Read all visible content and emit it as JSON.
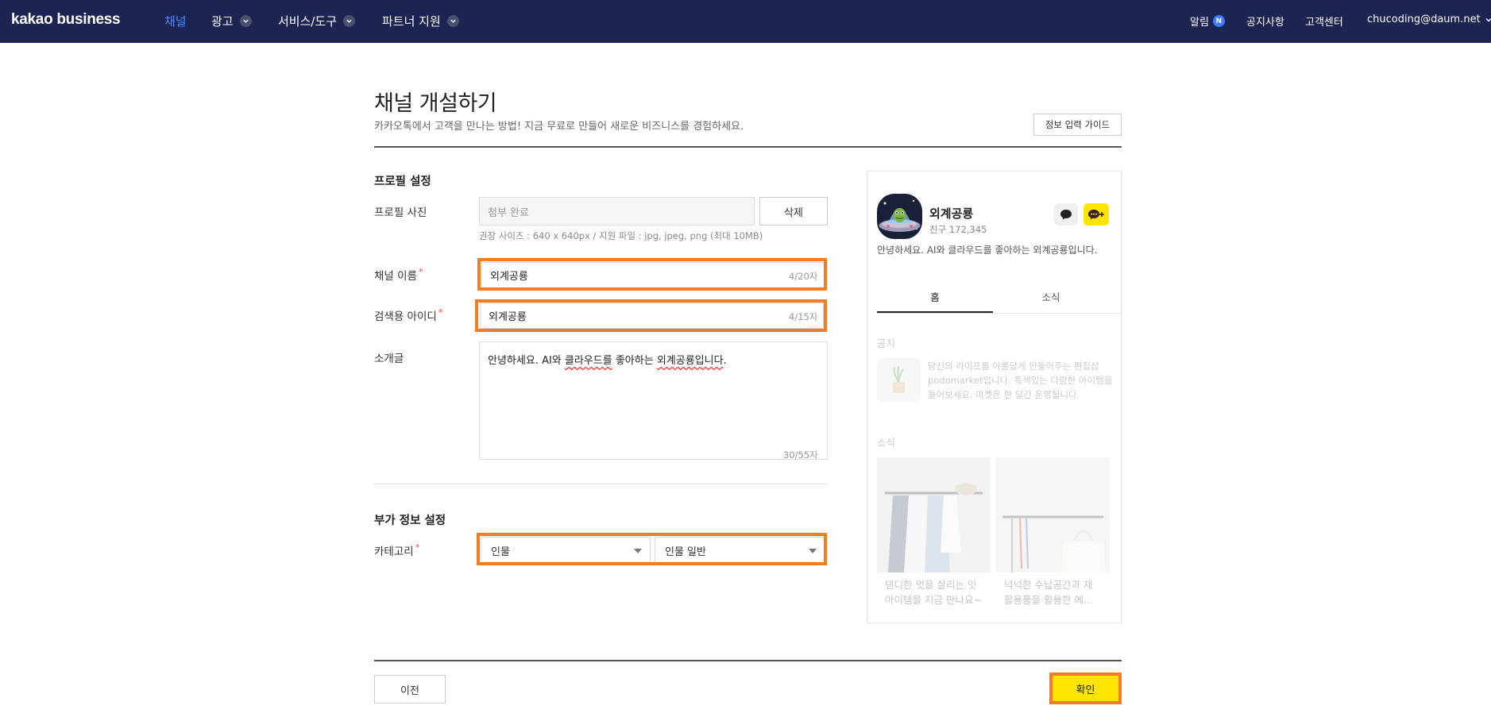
{
  "nav": {
    "logo": "kakao business",
    "items": [
      {
        "label": "채널",
        "active": true
      },
      {
        "label": "광고",
        "has_dropdown": true
      },
      {
        "label": "서비스/도구",
        "has_dropdown": true
      },
      {
        "label": "파트너 지원",
        "has_dropdown": true
      }
    ],
    "right": {
      "notifications": "알림",
      "badge": "N",
      "notices": "공지사항",
      "support": "고객센터",
      "account": "chucoding@daum.net"
    }
  },
  "header": {
    "title": "채널 개설하기",
    "subtitle": "카카오톡에서 고객을 만나는 방법! 지금 무료로 만들어 새로운 비즈니스를 경험하세요.",
    "guide_button": "정보 입력 가이드"
  },
  "profile": {
    "section_title": "프로필 설정",
    "photo": {
      "label": "프로필 사진",
      "value": "첨부 완료",
      "delete_label": "삭제",
      "hint": "권장 사이즈 : 640 x 640px / 지원 파일 : jpg, jpeg, png (최대 10MB)"
    },
    "channel_name": {
      "label": "채널 이름",
      "required": "*",
      "value": "외계공룡",
      "counter": "4/20자"
    },
    "search_id": {
      "label": "검색용 아이디",
      "required": "*",
      "value": "외계공룡",
      "counter": "4/15자"
    },
    "intro": {
      "label": "소개글",
      "part1": "안녕하세요. AI와 ",
      "part2": "클라우드를",
      "part3": " 좋아하는 ",
      "part4": "외계공룡입니다",
      "part5": ".",
      "counter": "30/55자"
    }
  },
  "extra": {
    "section_title": "부가 정보 설정",
    "category": {
      "label": "카테고리",
      "required": "*",
      "primary": "인물",
      "secondary": "인물 일반"
    }
  },
  "preview": {
    "name": "외계공룡",
    "friends": "친구 172,345",
    "intro": "안녕하세요. AI와 클라우드를 좋아하는 외계공룡입니다.",
    "tabs": [
      "홈",
      "소식"
    ],
    "notice_label": "공지",
    "notice_text": "당신의 라이프를 아름답게 만들어주는 편집샵 podomarket입니다. 특색있는 다양한 아이템을 둘어보세요. 마켓은 한 달간 운영됩니다.",
    "news_label": "소식",
    "news": [
      {
        "line1": "댄디한 멋을 살리는 잇",
        "line2": "아이템을 지금 만나요~"
      },
      {
        "line1": "넉넉한 수납공간과 재",
        "line2": "활용품을 활용한 에..."
      }
    ]
  },
  "footer": {
    "prev_label": "이전",
    "confirm_label": "확인"
  },
  "colors": {
    "nav_bg": "#1c2451",
    "nav_active": "#4d8cff",
    "accent_yellow": "#fee500",
    "highlight_orange": "#f57c20"
  }
}
